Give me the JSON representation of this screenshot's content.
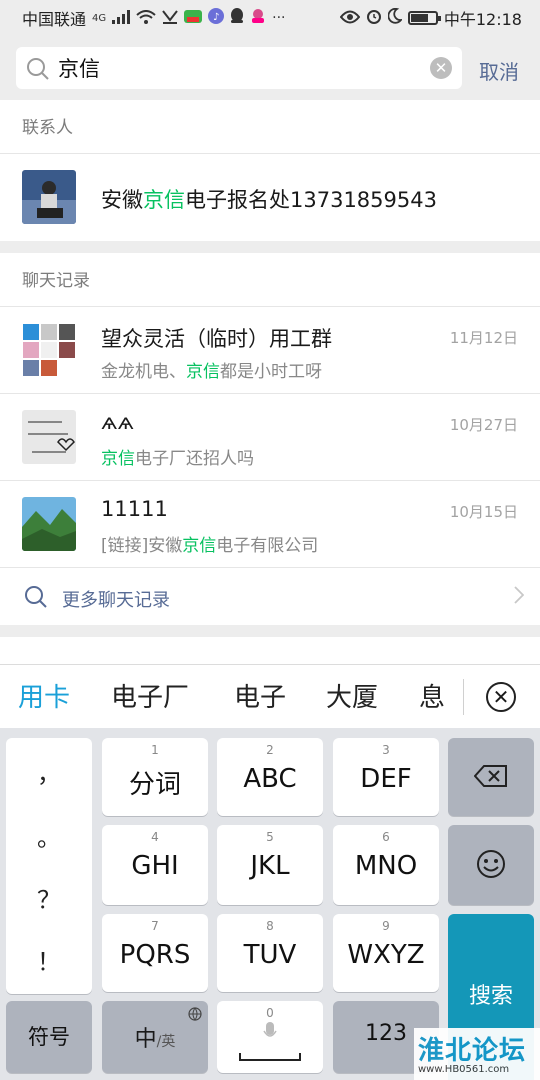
{
  "status_bar": {
    "carrier": "中国联通",
    "network": "4G",
    "time": "中午12:18",
    "battery_level": 0.72
  },
  "search": {
    "query": "京信",
    "cancel_label": "取消"
  },
  "contacts": {
    "header": "联系人",
    "items": [
      {
        "name_prefix": "安徽",
        "name_match": "京信",
        "name_suffix": "电子报名处13731859543"
      }
    ]
  },
  "chat_history": {
    "header": "聊天记录",
    "items": [
      {
        "title": "望众灵活（临时）用工群",
        "date": "11月12日",
        "sub_prefix": "金龙机电、",
        "sub_match": "京信",
        "sub_suffix": "都是小时工呀"
      },
      {
        "title": "ѧѧ",
        "date": "10月27日",
        "sub_prefix": "",
        "sub_match": "京信",
        "sub_suffix": "电子厂还招人吗"
      },
      {
        "title": "11111",
        "date": "10月15日",
        "sub_prefix": "[链接]安徽",
        "sub_match": "京信",
        "sub_suffix": "电子有限公司"
      }
    ],
    "more_label": "更多聊天记录"
  },
  "candidates": [
    "用卡",
    "电子厂",
    "电子",
    "大厦",
    "息"
  ],
  "keyboard": {
    "punctuation": [
      "，",
      "。",
      "？",
      "！"
    ],
    "keys": [
      {
        "num": "1",
        "label": "分词"
      },
      {
        "num": "2",
        "label": "ABC"
      },
      {
        "num": "3",
        "label": "DEF"
      },
      {
        "num": "4",
        "label": "GHI"
      },
      {
        "num": "5",
        "label": "JKL"
      },
      {
        "num": "6",
        "label": "MNO"
      },
      {
        "num": "7",
        "label": "PQRS"
      },
      {
        "num": "8",
        "label": "TUV"
      },
      {
        "num": "9",
        "label": "WXYZ"
      }
    ],
    "symbols_label": "符号",
    "lang_label_main": "中",
    "lang_label_sub": "/英",
    "space_num": "0",
    "numbers_label": "123",
    "search_label": "搜索"
  },
  "watermark": {
    "main": "淮北论坛",
    "sub": "www.HB0561.com"
  },
  "colors": {
    "highlight": "#07c160",
    "link": "#576b95",
    "search_key": "#1497b8",
    "candidate_active": "#1aa0d8"
  }
}
